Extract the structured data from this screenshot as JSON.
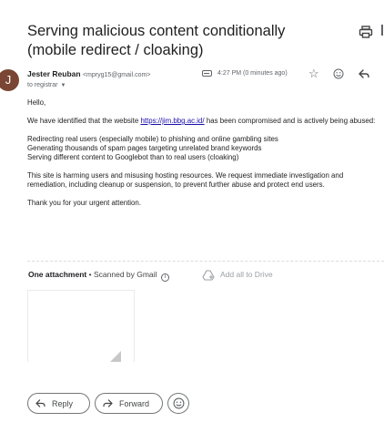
{
  "message": {
    "subject": "Serving malicious content conditionally (mobile redirect / cloaking)",
    "sender_name": "Jester Reuban",
    "sender_email": "<mpryg15@gmail.com>",
    "avatar_letter": "J",
    "recipient_line": "to registrar",
    "timestamp": "4:27 PM (0 minutes ago)",
    "greeting": "Hello,",
    "intro_before": "We have identified that the website ",
    "link_text": "https://jim.bbg.ac.id/",
    "intro_after": " has been compromised and is actively being abused:",
    "bullets": [
      "Redirecting real users (especially mobile) to phishing and online gambling sites",
      "Generating thousands of spam pages targeting unrelated brand keywords",
      "Serving different content to Googlebot than to real users (cloaking)"
    ],
    "request": "This site is harming users and misusing hosting resources. We request immediate investigation and remediation, including cleanup or suspension, to prevent further abuse and protect end users.",
    "closing": "Thank you for your urgent attention."
  },
  "attachments": {
    "count_label": "One attachment",
    "separator": "•",
    "scan_label": "Scanned by Gmail",
    "info_glyph": "i",
    "drive_label": "Add all to Drive"
  },
  "actions": {
    "reply_label": "Reply",
    "forward_label": "Forward"
  },
  "icons": {
    "print": "print-icon",
    "star": "star-icon",
    "emoji": "emoji-icon",
    "reply": "reply-icon",
    "forward": "forward-icon",
    "label": "label-icon",
    "drive": "drive-add-icon",
    "dropdown": "chevron-down-icon"
  },
  "colors": {
    "avatar": "#7a4633",
    "link": "#1a0dab"
  }
}
